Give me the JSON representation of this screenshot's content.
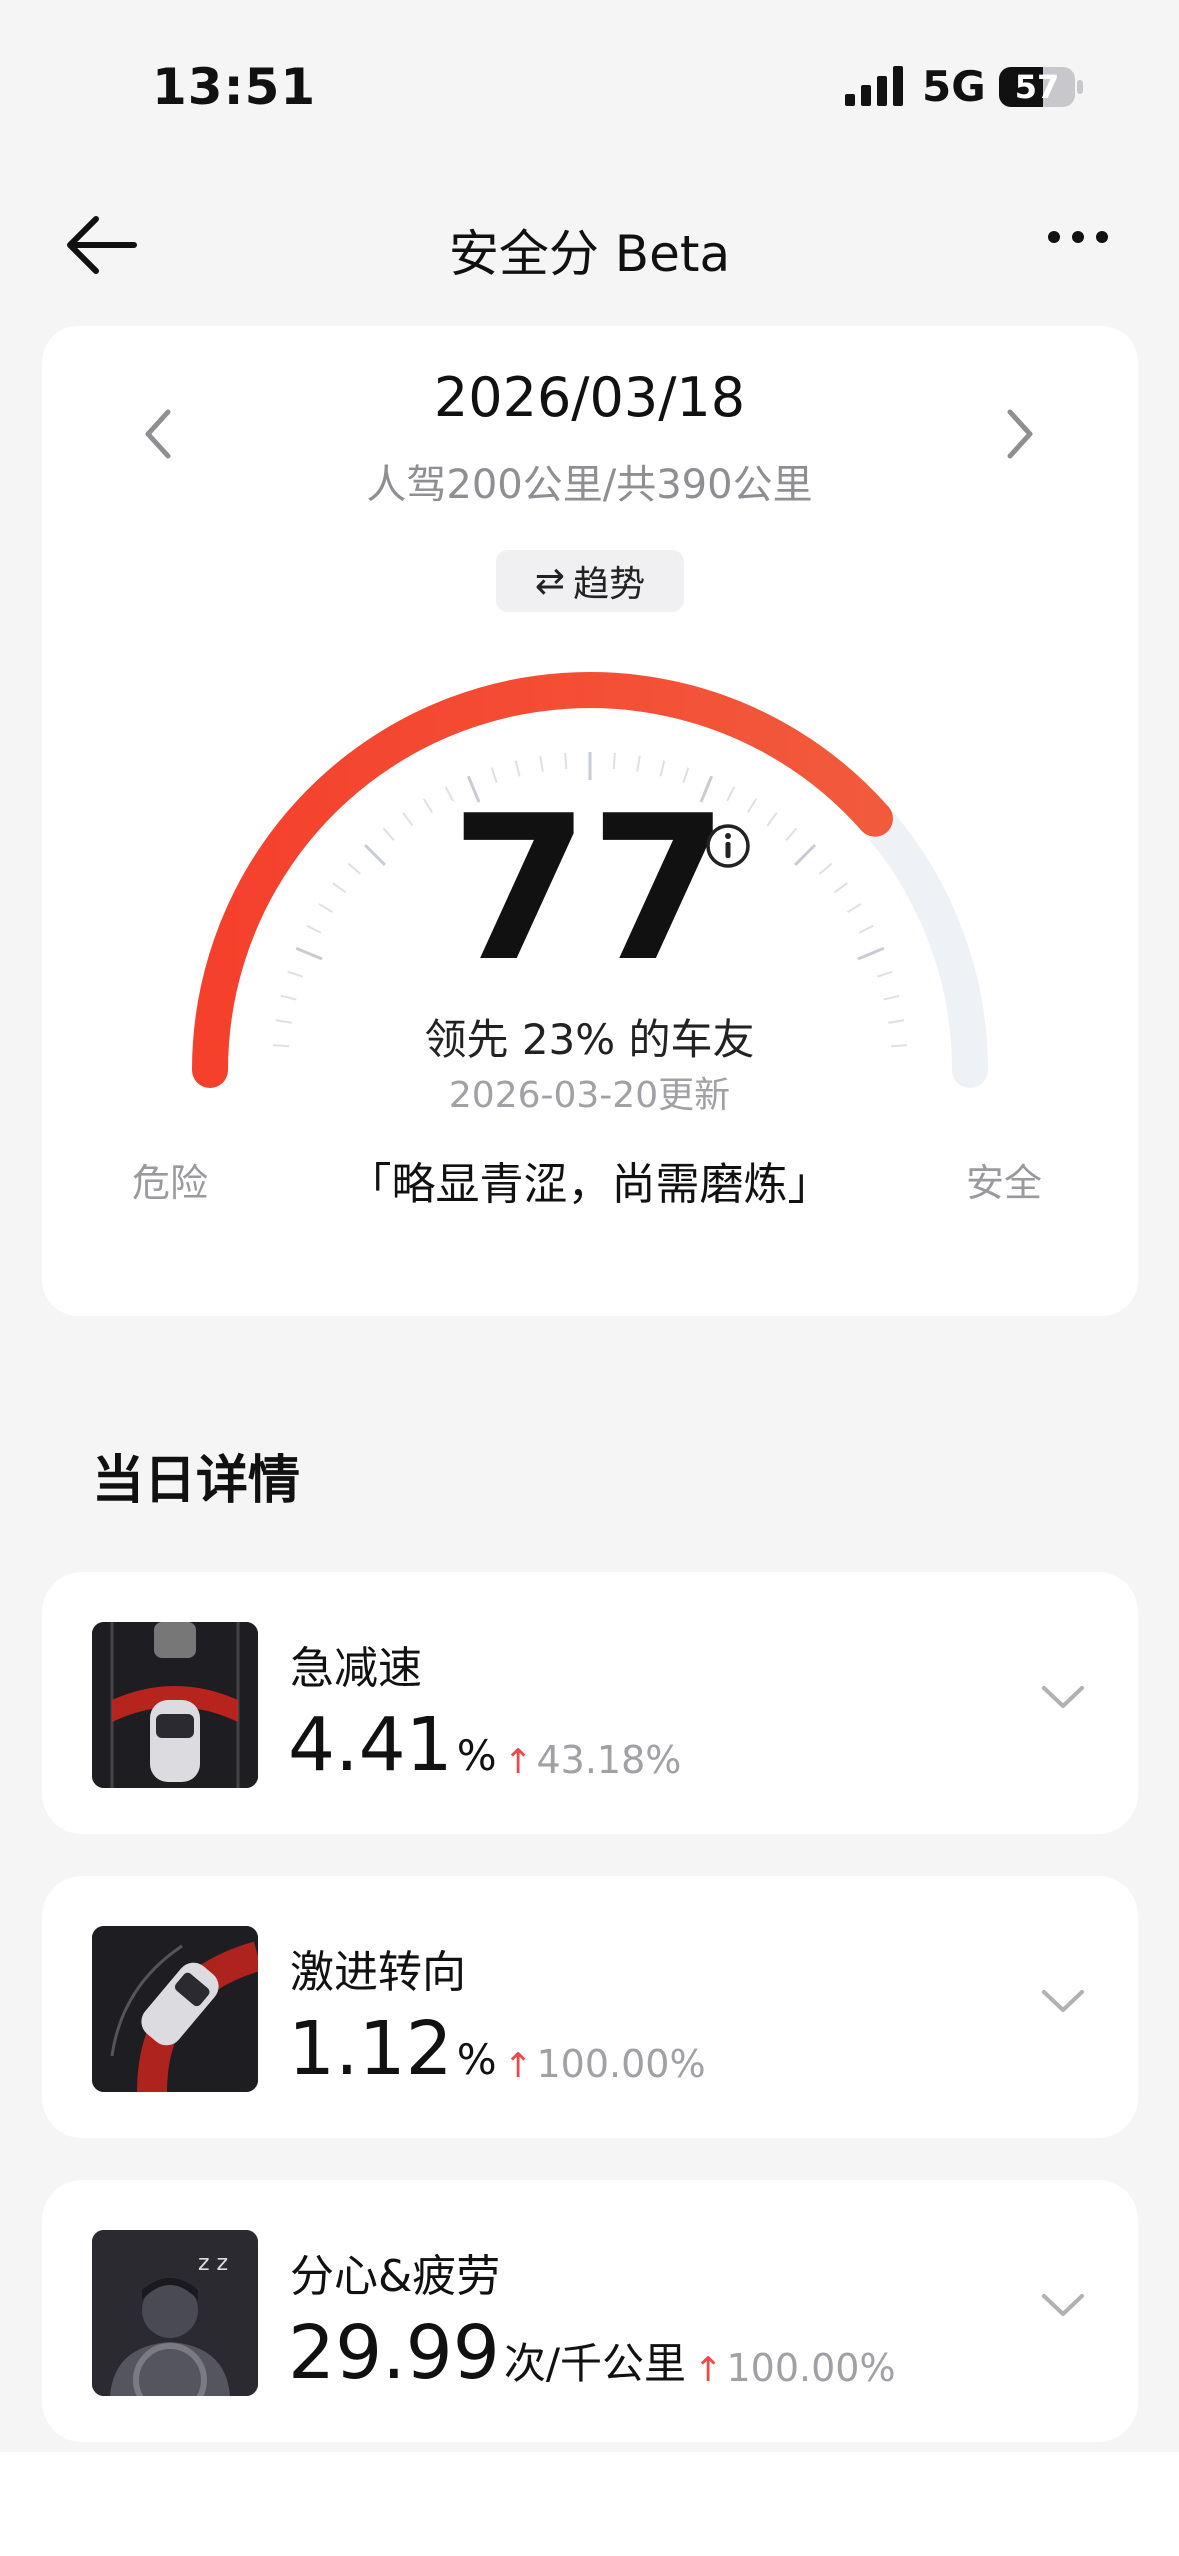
{
  "status_bar": {
    "time": "13:51",
    "network": "5G",
    "battery": "57"
  },
  "nav": {
    "title": "安全分 Beta"
  },
  "score_card": {
    "date": "2026/03/18",
    "distance_info": "人驾200公里/共390公里",
    "trend_button": "趋势",
    "trend_icon": "⇄",
    "score": "77",
    "score_max": 100,
    "rank_text": "领先 23% 的车友",
    "updated_text": "2026-03-20更新",
    "left_label": "危险",
    "right_label": "安全",
    "comment": "「略显青涩，尚需磨炼」",
    "gauge_color": "#f5402c"
  },
  "details": {
    "section_title": "当日详情",
    "items": [
      {
        "label": "急减速",
        "value": "4.41",
        "unit": "%",
        "change": "43.18%",
        "icon": "hard-braking-icon"
      },
      {
        "label": "激进转向",
        "value": "1.12",
        "unit": "%",
        "change": "100.00%",
        "icon": "aggressive-turn-icon"
      },
      {
        "label": "分心&疲劳",
        "value": "29.99",
        "unit": "次/千公里",
        "change": "100.00%",
        "icon": "distraction-fatigue-icon"
      }
    ]
  },
  "colors": {
    "accent": "#f5402c",
    "up_arrow": "#ef4a4a",
    "background": "#f5f5f6"
  }
}
